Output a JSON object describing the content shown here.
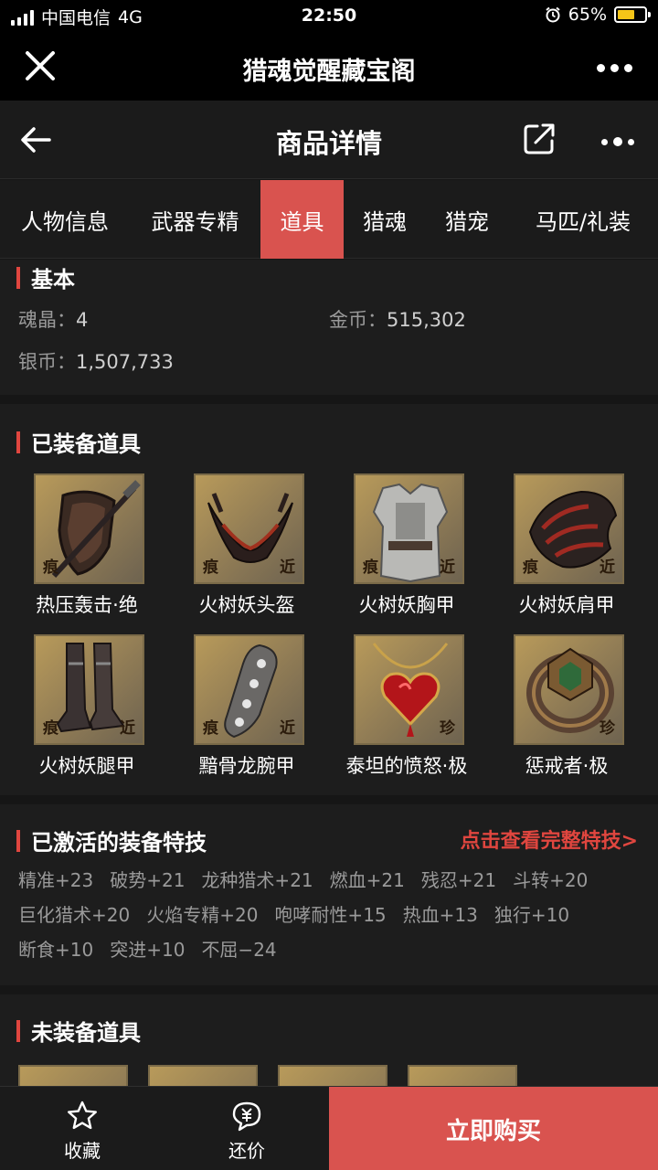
{
  "status_bar": {
    "carrier": "中国电信",
    "network": "4G",
    "time": "22:50",
    "battery": "65%",
    "battery_level": 0.65
  },
  "wechat_bar": {
    "title": "猎魂觉醒藏宝阁"
  },
  "app_bar": {
    "title": "商品详情"
  },
  "tabs": [
    {
      "label": "人物信息",
      "active": false
    },
    {
      "label": "武器专精",
      "active": false
    },
    {
      "label": "道具",
      "active": true
    },
    {
      "label": "猎魂",
      "active": false
    },
    {
      "label": "猎宠",
      "active": false
    },
    {
      "label": "马匹/礼装",
      "active": false
    }
  ],
  "basic": {
    "title": "基本",
    "soul_crystal": {
      "label": "魂晶：",
      "value": "4"
    },
    "gold": {
      "label": "金币：",
      "value": "515,302"
    },
    "silver": {
      "label": "银币：",
      "value": "1,507,733"
    }
  },
  "equipped": {
    "title": "已装备道具",
    "items": [
      {
        "name": "热压轰击·绝",
        "badge_left": "痕",
        "badge_right": "",
        "icon": "shield-lance-icon"
      },
      {
        "name": "火树妖头盔",
        "badge_left": "痕",
        "badge_right": "近",
        "icon": "horned-helmet-icon"
      },
      {
        "name": "火树妖胸甲",
        "badge_left": "痕",
        "badge_right": "近",
        "icon": "chest-armor-icon"
      },
      {
        "name": "火树妖肩甲",
        "badge_left": "痕",
        "badge_right": "近",
        "icon": "shoulder-armor-icon"
      },
      {
        "name": "火树妖腿甲",
        "badge_left": "痕",
        "badge_right": "近",
        "icon": "leg-armor-icon"
      },
      {
        "name": "黯骨龙腕甲",
        "badge_left": "痕",
        "badge_right": "近",
        "icon": "gauntlet-icon"
      },
      {
        "name": "泰坦的愤怒·极",
        "badge_left": "",
        "badge_right": "珍",
        "icon": "heart-pendant-icon"
      },
      {
        "name": "惩戒者·极",
        "badge_left": "",
        "badge_right": "珍",
        "icon": "ring-icon"
      }
    ]
  },
  "skills": {
    "title": "已激活的装备特技",
    "link": "点击查看完整特技>",
    "items": [
      "精准+23",
      "破势+21",
      "龙种猎术+21",
      "燃血+21",
      "残忍+21",
      "斗转+20",
      "巨化猎术+20",
      "火焰专精+20",
      "咆哮耐性+15",
      "热血+13",
      "独行+10",
      "断食+10",
      "突进+10",
      "不屈−24"
    ]
  },
  "unequipped": {
    "title": "未装备道具"
  },
  "bottom": {
    "favorite": "收藏",
    "bargain": "还价",
    "buy": "立即购买"
  },
  "colors": {
    "accent": "#d9534f",
    "link": "#e0463f",
    "background": "#1d1d1d"
  }
}
